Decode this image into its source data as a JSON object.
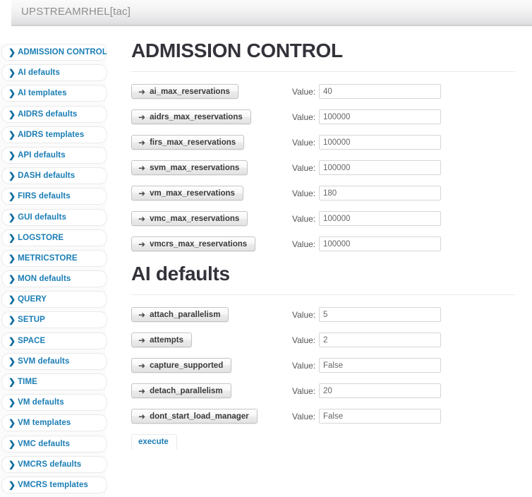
{
  "titlebar": {
    "title": "UPSTREAMRHEL[tac]"
  },
  "sidebar": {
    "items": [
      {
        "label": "ADMISSION CONTROL",
        "icon": "chevron-right-icon"
      },
      {
        "label": "AI defaults",
        "icon": "chevron-right-icon"
      },
      {
        "label": "AI templates",
        "icon": "chevron-right-icon"
      },
      {
        "label": "AIDRS defaults",
        "icon": "chevron-right-icon"
      },
      {
        "label": "AIDRS templates",
        "icon": "chevron-right-icon"
      },
      {
        "label": "API defaults",
        "icon": "chevron-right-icon"
      },
      {
        "label": "DASH defaults",
        "icon": "chevron-right-icon"
      },
      {
        "label": "FIRS defaults",
        "icon": "chevron-right-icon"
      },
      {
        "label": "GUI defaults",
        "icon": "chevron-right-icon"
      },
      {
        "label": "LOGSTORE",
        "icon": "chevron-right-icon"
      },
      {
        "label": "METRICSTORE",
        "icon": "chevron-right-icon"
      },
      {
        "label": "MON defaults",
        "icon": "chevron-right-icon"
      },
      {
        "label": "QUERY",
        "icon": "chevron-right-icon"
      },
      {
        "label": "SETUP",
        "icon": "chevron-right-icon"
      },
      {
        "label": "SPACE",
        "icon": "chevron-right-icon"
      },
      {
        "label": "SVM defaults",
        "icon": "chevron-right-icon"
      },
      {
        "label": "TIME",
        "icon": "chevron-right-icon"
      },
      {
        "label": "VM defaults",
        "icon": "chevron-right-icon"
      },
      {
        "label": "VM templates",
        "icon": "chevron-right-icon"
      },
      {
        "label": "VMC defaults",
        "icon": "chevron-right-icon"
      },
      {
        "label": "VMCRS defaults",
        "icon": "chevron-right-icon"
      },
      {
        "label": "VMCRS templates",
        "icon": "chevron-right-icon"
      }
    ]
  },
  "main": {
    "value_label": "Value:",
    "arrow_icon": "arrow-right-icon",
    "sections": [
      {
        "title": "ADMISSION CONTROL",
        "rows": [
          {
            "name": "ai_max_reservations",
            "value": "40"
          },
          {
            "name": "aidrs_max_reservations",
            "value": "100000"
          },
          {
            "name": "firs_max_reservations",
            "value": "100000"
          },
          {
            "name": "svm_max_reservations",
            "value": "100000"
          },
          {
            "name": "vm_max_reservations",
            "value": "180"
          },
          {
            "name": "vmc_max_reservations",
            "value": "100000"
          },
          {
            "name": "vmcrs_max_reservations",
            "value": "100000"
          }
        ]
      },
      {
        "title": "AI defaults",
        "rows": [
          {
            "name": "attach_parallelism",
            "value": "5"
          },
          {
            "name": "attempts",
            "value": "2"
          },
          {
            "name": "capture_supported",
            "value": "False"
          },
          {
            "name": "detach_parallelism",
            "value": "20"
          },
          {
            "name": "dont_start_load_manager",
            "value": "False"
          }
        ],
        "partial_row": {
          "name": "execute"
        }
      }
    ]
  },
  "colors": {
    "link": "#1a7db5",
    "heading": "#34323a",
    "titlebar_text": "#8e8e8e"
  }
}
